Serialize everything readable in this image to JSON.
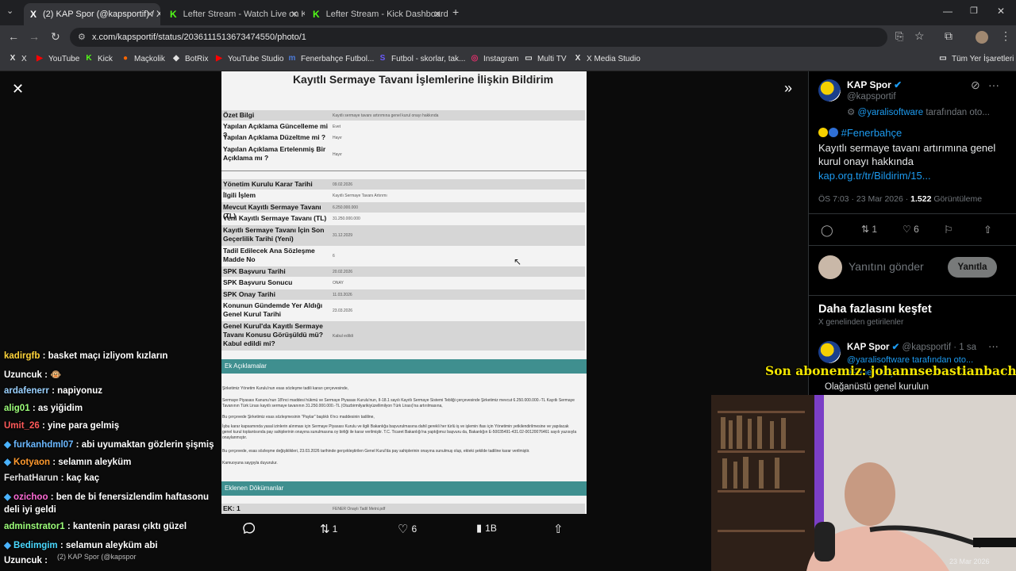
{
  "browser": {
    "tabs": [
      {
        "label": "(2) KAP Spor (@kapsportif) / X"
      },
      {
        "label": "Lefter Stream - Watch Live on K"
      },
      {
        "label": "Lefter Stream - Kick Dashboard"
      }
    ],
    "url": "x.com/kapsportif/status/2036111513673474550/photo/1",
    "bookmarks": [
      "X",
      "YouTube",
      "Kick",
      "Maçkolik",
      "BotRix",
      "YouTube Studio",
      "Fenerbahçe Futbol...",
      "Futbol - skorlar, tak...",
      "Instagram",
      "Multi TV",
      "X Media Studio"
    ],
    "all_bookmarks": "Tüm Yer İşaretleri"
  },
  "document": {
    "title": "Kayıtlı Sermaye Tavanı İşlemlerine İlişkin Bildirim",
    "rows_top": [
      {
        "key": "Özet Bilgi",
        "value": "Kayıtlı sermaye tavanı artırımına genel kurul onayı hakkında"
      },
      {
        "key": "Yapılan Açıklama Güncelleme mi ?",
        "value": "Evet"
      },
      {
        "key": "Yapılan Açıklama Düzeltme mi ?",
        "value": "Hayır"
      },
      {
        "key": "Yapılan Açıklama Ertelenmiş Bir Açıklama mı ?",
        "value": "Hayır"
      }
    ],
    "rows_main": [
      {
        "key": "Yönetim Kurulu Karar Tarihi",
        "value": "09.02.2026"
      },
      {
        "key": "İlgili İşlem",
        "value": "Kayıtlı Sermaye Tavanı Artırımı"
      },
      {
        "key": "Mevcut Kayıtlı Sermaye Tavanı (TL)",
        "value": "6.250.000.000"
      },
      {
        "key": "Yeni Kayıtlı Sermaye Tavanı (TL)",
        "value": "31.250.000.000"
      },
      {
        "key": "Kayıtlı Sermaye Tavanı İçin Son Geçerlilik Tarihi (Yeni)",
        "value": "31.12.2029"
      },
      {
        "key": "Tadil Edilecek Ana Sözleşme Madde No",
        "value": "6"
      },
      {
        "key": "SPK Başvuru Tarihi",
        "value": "20.02.2026"
      },
      {
        "key": "SPK Başvuru Sonucu",
        "value": "ONAY"
      },
      {
        "key": "SPK Onay Tarihi",
        "value": "11.03.2026"
      },
      {
        "key": "Konunun Gündemde Yer Aldığı Genel Kurul Tarihi",
        "value": "23.03.2026"
      },
      {
        "key": "Genel Kurul'da Kayıtlı Sermaye Tavanı Konusu Görüşüldü mü? Kabul edildi mi?",
        "value": "Kabul edildi"
      }
    ],
    "section1": "Ek Açıklamalar",
    "paragraphs": [
      "Şirketimiz Yönetim Kurulu'nun esas sözleşme tadili kararı çerçevesinde,",
      "Sermaye Piyasası Kanunu'nun 18'inci maddesi hükmü ve Sermaye Piyasası Kurulu'nun, II-18.1 sayılı Kayıtlı Sermaye Sistemi Tebliği çerçevesinde Şirketimiz mevcut 6.250.000.000.-TL Kayıtlı Sermaye Tavanının Türk Lirası kayıtlı sermaye tavanının 31.250.000.000.-TL (Otuzbirmilyarikiyüzellimilyon Türk Lirası)'na artırılmasına,",
      "Bu çerçevede Şirketimiz esas sözleşmesinin \"Paylar\" başlıklı 6'ncı maddesinin tadiline,",
      "İşbu karar kapsamında yasal izinlerin alınması için Sermaye Piyasası Kurulu ve ilgili Bakanlığa başvurulmasına dahil gerekli her türlü iş ve işlemin ifası için Yönetimin yetkilendirilmesine ve yapılacak genel kurul toplantısında pay sahiplerinin onayına sunulmasına oy birliği ile karar verilmiştir. T.C. Ticaret Bakanlığı'na yaptığımız başvuru da, Bakanlığın E-50035491-431.02-00120076461 sayılı yazısıyla onaylanmıştır.",
      "Bu çerçevede, esas sözleşme değişiklikleri, 23.03.2026 tarihinde gerçekleştirilen Genel Kurul'da pay sahiplerinin onayına sunulmuş olup, ekteki şekilde tadiline karar verilmiştir.",
      "Kamuoyuna saygıyla duyurulur."
    ],
    "section2": "Eklenen Dökümanlar",
    "attachment_key": "EK: 1",
    "attachment_value": "FENER Onaylı Tadil Metni.pdf"
  },
  "viewer_actions": {
    "retweets": "1",
    "likes": "6",
    "views": "1B"
  },
  "chat": [
    {
      "user": "kadirgfb",
      "color": "#ffd43b",
      "text": ": basket maçı izliyom kızların"
    },
    {
      "user": "Uzuncuk",
      "color": "#ffffff",
      "text": ": 🐵"
    },
    {
      "user": "ardafenerr",
      "color": "#9ad1ff",
      "text": ": napiyonuz"
    },
    {
      "user": "alig01",
      "color": "#9dff7a",
      "text": ": as yiğidim"
    },
    {
      "user": "Umit_26",
      "color": "#ff5a5a",
      "text": ": yine para gelmiş"
    },
    {
      "user": "furkanhdml07",
      "color": "#6bb8ff",
      "text": ": abi uyumaktan gözlerin şişmiş"
    },
    {
      "user": "Kotyaon",
      "color": "#ff9a2e",
      "text": ": selamın aleyküm"
    },
    {
      "user": "FerhatHarun",
      "color": "#e0e0e0",
      "text": ": kaç kaç"
    },
    {
      "user": "ozichoo",
      "color": "#ff6bd6",
      "text": ": ben de bi fenersizlendim haftasonu"
    },
    {
      "user": "",
      "color": "#ffffff",
      "text": "deli iyi geldi"
    },
    {
      "user": "adminstrator1",
      "color": "#9dff7a",
      "text": ": kantenin parası çıktı güzel"
    },
    {
      "user": "Bedimgim",
      "color": "#4ad9ff",
      "text": ": selamun aleyküm abi"
    },
    {
      "user": "Uzuncuk",
      "color": "#ffffff",
      "text": ":"
    }
  ],
  "tweet": {
    "name": "KAP Spor",
    "handle": "@kapsportif",
    "via": "@yaralisoftware",
    "via_suffix": "tarafından oto...",
    "hashtag": "#Fenerbahçe",
    "text": "Kayıtlı sermaye tavanı artırımına genel kurul onayı hakkında",
    "link": "kap.org.tr/tr/Bildirim/15...",
    "time": "ÖS 7:03 · 23 Mar 2026 · ",
    "views": "1.522",
    "views_label": "Görüntüleme",
    "retweets": "1",
    "likes": "6",
    "reply_placeholder": "Yanıtını gönder",
    "reply_button": "Yanıtla",
    "more_title": "Daha fazlasını keşfet",
    "more_sub": "X genelinden getirilenler",
    "tweet2_meta": "@kapsportif · 1 sa",
    "tweet2_via": "@yaralisoftware tarafından oto...",
    "tweet2_text": "Olağanüstü genel kurulun",
    "tweet2_hashtag": "#Fenerbahçe"
  },
  "overlay": {
    "sub_alert": "Son abonemiz: johannsebastianbach",
    "taskbar_date": "23 Mar 2026",
    "taskbar_preview": "(2) KAP Spor (@kapspor"
  }
}
